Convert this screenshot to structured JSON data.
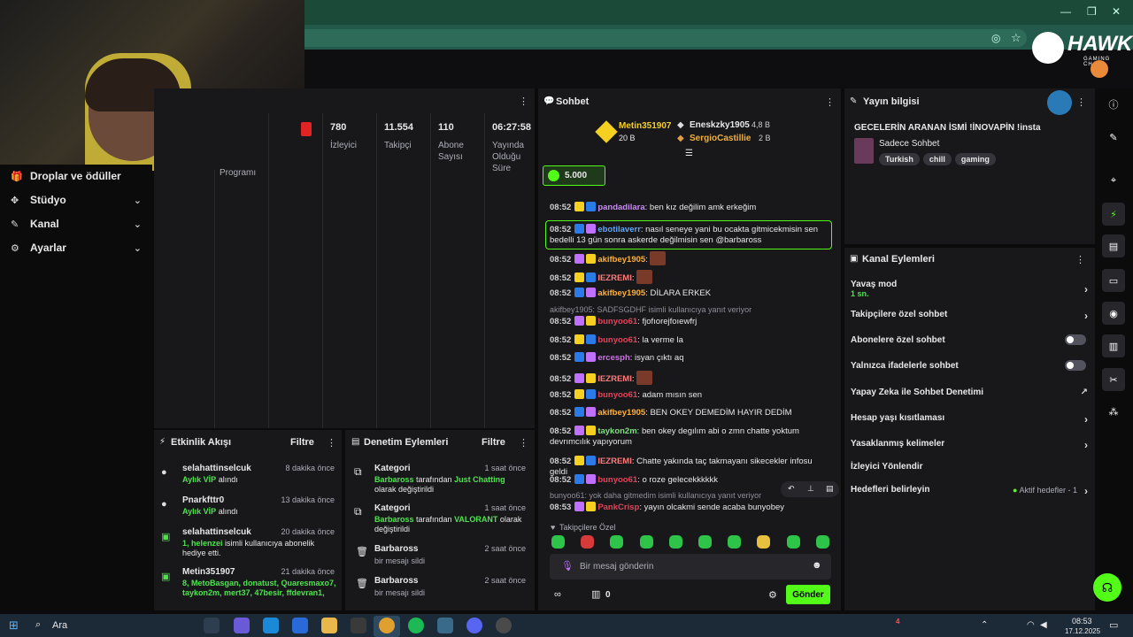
{
  "browser": {
    "window_controls": [
      "—",
      "❐",
      "✕"
    ]
  },
  "logo": {
    "text": "HAWK",
    "subtitle": "GAMING CHAIR"
  },
  "sidebar": {
    "items": [
      {
        "label": "Droplar ve ödüller",
        "icon": "gift-icon"
      },
      {
        "label": "Stüdyo",
        "icon": "studio-icon",
        "chevron": "⌄"
      },
      {
        "label": "Kanal",
        "icon": "channel-icon",
        "chevron": "⌄"
      },
      {
        "label": "Ayarlar",
        "icon": "gear-icon",
        "chevron": "⌄"
      }
    ]
  },
  "stats": {
    "partial_label": "Programı",
    "items": [
      {
        "value": "780",
        "label": "İzleyici"
      },
      {
        "value": "11.554",
        "label": "Takipçi"
      },
      {
        "value": "110",
        "label": "Abone Sayısı"
      },
      {
        "value": "06:27:58",
        "label": "Yayında Olduğu Süre"
      }
    ]
  },
  "activity": {
    "title": "Etkinlik Akışı",
    "filter": "Filtre",
    "items": [
      {
        "name": "selahattinselcuk",
        "time": "8 dakika önce",
        "sub_green": "Aylık VİP",
        "sub": " alındı"
      },
      {
        "name": "Pnarkfttr0",
        "time": "13 dakika önce",
        "sub_green": "Aylık VİP",
        "sub": " alındı"
      },
      {
        "name": "selahattinselcuk",
        "time": "20 dakika önce",
        "sub_green": "1, helenzei",
        "sub": " isimli kullanıcıya abonelik hediye etti."
      },
      {
        "name": "Metin351907",
        "time": "21 dakika önce",
        "sub_green": "8, MetoBasgan, donatust, Quaresmaxo7, taykon2m, mert37, 47besir, ffdevran1,",
        "sub": ""
      }
    ]
  },
  "moderation": {
    "title": "Denetim Eylemleri",
    "filter": "Filtre",
    "items": [
      {
        "name": "Kategori",
        "time": "1 saat önce",
        "actor": "Barbaross",
        "mid": " tarafından ",
        "value": "Just Chatting",
        "end": " olarak değiştirildi"
      },
      {
        "name": "Kategori",
        "time": "1 saat önce",
        "actor": "Barbaross",
        "mid": " tarafından ",
        "value": "VALORANT",
        "end": " olarak değiştirildi"
      },
      {
        "name": "Barbaross",
        "time": "2 saat önce",
        "sub": "bir mesajı sildi"
      },
      {
        "name": "Barbaross",
        "time": "2 saat önce",
        "sub": "bir mesajı sildi"
      }
    ]
  },
  "chat": {
    "title": "Sohbet",
    "top_gifter": {
      "name": "Metin351907",
      "amount": "20 B"
    },
    "gifters": [
      {
        "name": "Eneskzky1905",
        "amount": "4,8 B"
      },
      {
        "name": "SergioCastillie",
        "amount": "2 B"
      }
    ],
    "goal": "5.000",
    "messages": [
      {
        "time": "08:52",
        "user": "pandadilara",
        "color": "#c98bf5",
        "text": "ben kız değilim amk erkeğim"
      },
      {
        "time": "08:52",
        "user": "ebotilaverr",
        "color": "#5aa8ff",
        "text": "nasıl seneye yani bu ocakta gitmicekmisin sen bedelli 13 gün sonra askerde değilmisin sen @barbaross",
        "highlight": true
      },
      {
        "time": "08:52",
        "user": "akifbey1905",
        "color": "#ffb03a",
        "text": "",
        "emote": true
      },
      {
        "time": "08:52",
        "user": "IEZREMI",
        "color": "#ff7a7a",
        "text": "",
        "emote": true
      },
      {
        "time": "08:52",
        "user": "akifbey1905",
        "color": "#ffb03a",
        "text": "DİLARA ERKEK"
      },
      {
        "time": "08:52",
        "user": "bunyoo61",
        "color": "#e0445a",
        "text": "fjofıorejfoıewfrj",
        "reply": "akifbey1905: SADFSGDHF isimli kullanıcıya yanıt veriyor"
      },
      {
        "time": "08:52",
        "user": "bunyoo61",
        "color": "#e0445a",
        "text": "la verme la"
      },
      {
        "time": "08:52",
        "user": "ercesph",
        "color": "#d070e8",
        "text": "isyan çıktı aq"
      },
      {
        "time": "08:52",
        "user": "IEZREMI",
        "color": "#ff7a7a",
        "text": "",
        "emote": true
      },
      {
        "time": "08:52",
        "user": "bunyoo61",
        "color": "#e0445a",
        "text": "adam mısın sen"
      },
      {
        "time": "08:52",
        "user": "akifbey1905",
        "color": "#ffb03a",
        "text": "BEN OKEY DEMEDİM HAYIR DEDİM"
      },
      {
        "time": "08:52",
        "user": "taykon2m",
        "color": "#7fe07f",
        "text": "ben okey degılım abi o zmn chatte yoktum devrımcılık yapıyorum"
      },
      {
        "time": "08:52",
        "user": "IEZREMI",
        "color": "#ff7a7a",
        "text": "Chatte yakında taç takmayanı sikecekler infosu geldi"
      },
      {
        "time": "08:52",
        "user": "bunyoo61",
        "color": "#e0445a",
        "text": "o roze gelecekkkkkk"
      },
      {
        "time": "08:53",
        "user": "PankCrisp",
        "color": "#e0445a",
        "text": "yayın olcakmi sende acaba bunyobey",
        "reply": "bunyoo61: yok daha gitmedim isimli kullanıcıya yanıt veriyor"
      }
    ],
    "followers_only": "Takipçilere Özel",
    "input_placeholder": "Bir mesaj gönderin",
    "points": "0",
    "send": "Gönder"
  },
  "stream_info": {
    "title": "Yayın bilgisi",
    "stream_title": "GECELERİN ARANAN İSMİ !İNOVAPİN !insta",
    "category": "Sadece Sohbet",
    "tags": [
      "Turkish",
      "chill",
      "gaming"
    ]
  },
  "channel_actions": {
    "title": "Kanal Eylemleri",
    "slow_mode": "Yavaş mod",
    "slow_value": "1 sn.",
    "rows": [
      {
        "label": "Takipçilere özel sohbet",
        "kind": "chevron"
      },
      {
        "label": "Abonelere özel sohbet",
        "kind": "toggle"
      },
      {
        "label": "Yalnızca ifadelerle sohbet",
        "kind": "toggle"
      },
      {
        "label": "Yapay Zeka ile Sohbet Denetimi",
        "kind": "external"
      },
      {
        "label": "Hesap yaşı kısıtlaması",
        "kind": "chevron"
      },
      {
        "label": "Yasaklanmış kelimeler",
        "kind": "chevron"
      },
      {
        "label": "İzleyici Yönlendir",
        "kind": "none"
      }
    ],
    "goals": "Hedefleri belirleyin",
    "goals_status": "Aktif hedefler - 1"
  },
  "taskbar": {
    "search": "Ara",
    "notif": "4",
    "time": "08:53",
    "date": "17.12.2025"
  },
  "colors": {
    "accent": "#53fc18",
    "panel": "#18181b",
    "bg": "#0b0b0c"
  }
}
